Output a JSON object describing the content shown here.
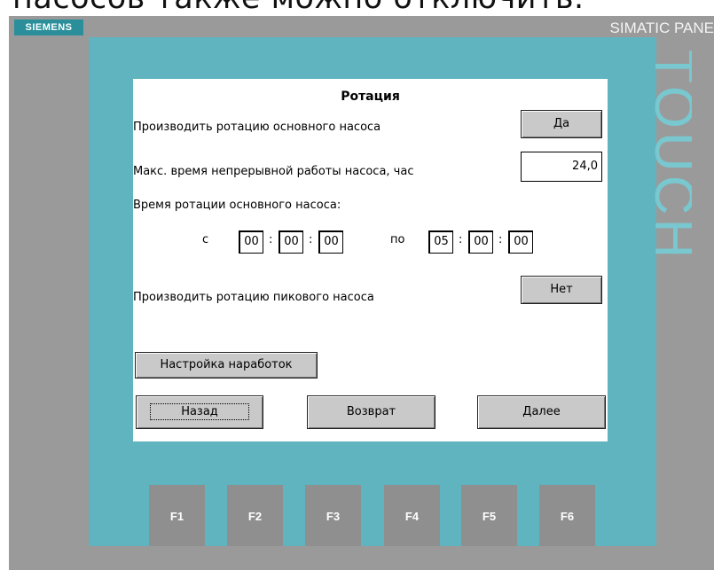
{
  "caption": "насосов также можно отключить.",
  "device": {
    "brand": "SIEMENS",
    "model": "SIMATIC PANE",
    "touch": "TOUCH"
  },
  "screen": {
    "title": "Ротация",
    "rotate_main_label": "Производить ротацию основного насоса",
    "rotate_main_value": "Да",
    "max_time_label": "Макс. время непрерывной работы насоса, час",
    "max_time_value": "24,0",
    "rotation_time_label": "Время ротации основного насоса:",
    "from_label": "с",
    "to_label": "по",
    "from_time": [
      "00",
      "00",
      "00"
    ],
    "to_time": [
      "05",
      "00",
      "00"
    ],
    "colon": ":",
    "rotate_peak_label": "Производить ротацию пикового насоса",
    "rotate_peak_value": "Нет",
    "settings_button": "Настройка наработок",
    "back_button": "Назад",
    "return_button": "Возврат",
    "next_button": "Далее"
  },
  "function_keys": [
    "F1",
    "F2",
    "F3",
    "F4",
    "F5",
    "F6"
  ]
}
